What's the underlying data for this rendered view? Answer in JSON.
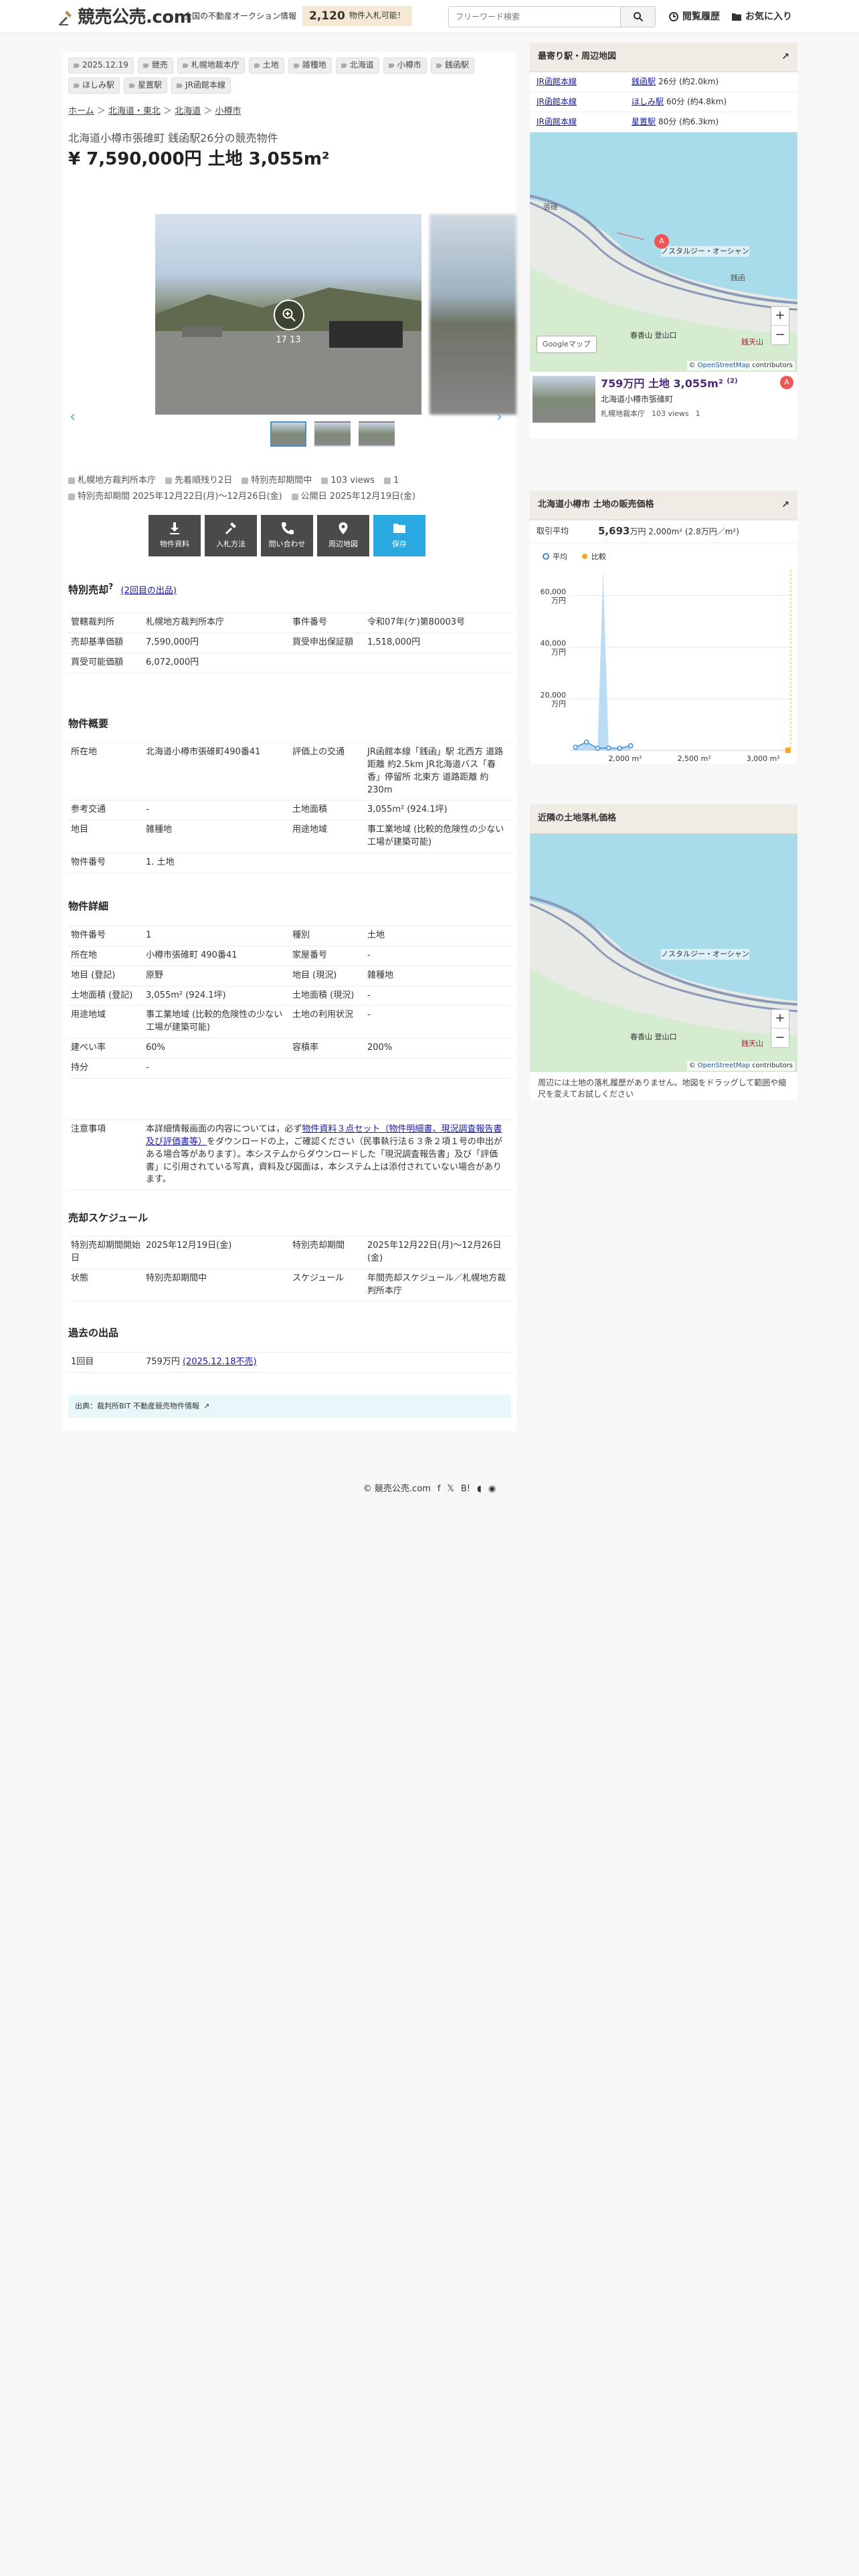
{
  "header": {
    "logo_text": "競売公売.com",
    "tagline": "全国の不動産オークション情報",
    "count_value": "2,120",
    "count_suffix": "物件入札可能！",
    "search_placeholder": "フリーワード検索",
    "history_label": "閲覧履歴",
    "favorites_label": "お気に入り"
  },
  "tags": [
    "2025.12.19",
    "競売",
    "札幌地裁本庁",
    "土地",
    "雑種地",
    "北海道",
    "小樽市",
    "銭函駅",
    "ほしみ駅",
    "星置駅",
    "JR函館本線"
  ],
  "breadcrumb": [
    "ホーム",
    "北海道・東北",
    "北海道",
    "小樽市"
  ],
  "listing": {
    "subtitle": "北海道小樽市張碓町 銭函駅26分の競売物件",
    "title": "¥ 7,590,000円 土地 3,055m²",
    "photo_count": "17 13"
  },
  "meta": {
    "court": "札幌地方裁判所本庁",
    "remaining": "先着順残り2日",
    "status": "特別売却期間中",
    "views": "103 views",
    "fav": "1",
    "period": "特別売却期間 2025年12月22日(月)〜12月26日(金)",
    "published": "公開日 2025年12月19日(金)"
  },
  "actions": [
    "物件資料",
    "入札方法",
    "問い合わせ",
    "周辺地図",
    "保存"
  ],
  "special_sale": {
    "heading": "特別売却",
    "sup": "?",
    "link": "(2回目の出品)",
    "rows": [
      {
        "k1": "管轄裁判所",
        "v1": "札幌地方裁判所本庁",
        "k2": "事件番号",
        "v2": "令和07年(ケ)第80003号"
      },
      {
        "k1": "売却基準価額",
        "v1": "7,590,000円",
        "k2": "買受申出保証額",
        "v2": "1,518,000円"
      },
      {
        "k1": "買受可能価額",
        "v1": "6,072,000円",
        "k2": "",
        "v2": ""
      }
    ]
  },
  "overview": {
    "heading": "物件概要",
    "rows": [
      {
        "k1": "所在地",
        "v1": "北海道小樽市張碓町490番41",
        "k2": "評価上の交通",
        "v2": "JR函館本線「銭函」駅 北西方 道路距離 約2.5km JR北海道バス「春香」停留所 北東方 道路距離 約230m"
      },
      {
        "k1": "参考交通",
        "v1": "-",
        "k2": "土地面積",
        "v2": "3,055m² (924.1坪)"
      },
      {
        "k1": "地目",
        "v1": "雑種地",
        "k2": "用途地域",
        "v2": "事工業地域 (比較的危険性の少ない工場が建築可能)"
      },
      {
        "k1": "物件番号",
        "v1": "1. 土地",
        "k2": "",
        "v2": ""
      }
    ]
  },
  "details": {
    "heading": "物件詳細",
    "rows": [
      {
        "k1": "物件番号",
        "v1": "1",
        "k2": "種別",
        "v2": "土地"
      },
      {
        "k1": "所在地",
        "v1": "小樽市張碓町 490番41",
        "k2": "家屋番号",
        "v2": "-"
      },
      {
        "k1": "地目 (登記)",
        "v1": "原野",
        "k2": "地目 (現況)",
        "v2": "雑種地"
      },
      {
        "k1": "土地面積 (登記)",
        "v1": "3,055m² (924.1坪)",
        "k2": "土地面積 (現況)",
        "v2": "-"
      },
      {
        "k1": "用途地域",
        "v1": "事工業地域 (比較的危険性の少ない工場が建築可能)",
        "k2": "土地の利用状況",
        "v2": "-"
      },
      {
        "k1": "建ぺい率",
        "v1": "60%",
        "k2": "容積率",
        "v2": "200%"
      },
      {
        "k1": "持分",
        "v1": "-",
        "k2": "",
        "v2": ""
      }
    ]
  },
  "notes": {
    "label": "注意事項",
    "text1": "本詳細情報画面の内容については，必ず",
    "link": "物件資料３点セット（物件明細書、現況調査報告書及び評価書等）",
    "text2": "をダウンロードの上，ご確認ください（民事執行法６３条２項１号の申出がある場合等があります）。本システムからダウンロードした「現況調査報告書」及び「評価書」に引用されている写真，資料及び図面は，本システム上は添付されていない場合があります。"
  },
  "schedule": {
    "heading": "売却スケジュール",
    "rows": [
      {
        "k1": "特別売却期間開始日",
        "v1": "2025年12月19日(金)",
        "k2": "特別売却期間",
        "v2": "2025年12月22日(月)〜12月26日(金)"
      },
      {
        "k1": "状態",
        "v1": "特別売却期間中",
        "k2": "スケジュール",
        "v2": "年間売却スケジュール／札幌地方裁判所本庁"
      }
    ]
  },
  "past": {
    "heading": "過去の出品",
    "k": "1回目",
    "v": "759万円",
    "link": "(2025.12.18不売)"
  },
  "source": "出典：裁判所BIT 不動産競売物件情報",
  "footer": "© 競売公売.com",
  "nearby": {
    "heading": "最寄り駅・周辺地図",
    "rows": [
      {
        "line": "JR函館本線",
        "station": "銭函駅",
        "info": "26分 (約2.0km)"
      },
      {
        "line": "JR函館本線",
        "station": "ほしみ駅",
        "info": "60分 (約4.8km)"
      },
      {
        "line": "JR函館本線",
        "station": "星置駅",
        "info": "80分 (約6.3km)"
      }
    ],
    "map_labels": [
      "張碓",
      "銭函",
      "ノスタルジー・オーシャン",
      "春香山 登山口",
      "銭天山"
    ],
    "google_btn": "Googleマップ",
    "osm_prefix": "©",
    "osm_link": "OpenStreetMap",
    "osm_suffix": "contributors",
    "marker": "A",
    "card_price": "759万円 土地 3,055m²",
    "card_price_sup": "(2)",
    "card_addr": "北海道小樽市張碓町",
    "card_court": "札幌地裁本庁",
    "card_views": "103 views",
    "card_fav": "1"
  },
  "price_chart": {
    "heading": "北海道小樽市 土地の販売価格",
    "avg_label": "取引平均",
    "avg_value": "5,693",
    "avg_unit": "万円 2,000m² (2.8万円／m²)",
    "legend": [
      "平均",
      "比較"
    ]
  },
  "chart_data": {
    "type": "area",
    "yticks": [
      "20,000\n万円",
      "40,000\n万円",
      "60,000\n万円"
    ],
    "xticks": [
      "2,000 m²",
      "2,500 m²",
      "3,000 m²"
    ],
    "ylim": [
      0,
      70000
    ],
    "xlim": [
      1600,
      3200
    ],
    "series": [
      {
        "name": "平均",
        "x": [
          1640,
          1720,
          1800,
          1880,
          1960,
          2040
        ],
        "values": [
          1200,
          3200,
          800,
          900,
          800,
          1800
        ]
      },
      {
        "name": "比較",
        "x": [
          3180
        ],
        "values": [
          0
        ]
      }
    ],
    "spike": {
      "x": 1840,
      "value": 72000
    }
  },
  "land_price": {
    "heading": "近隣の土地落札価格",
    "note": "周辺には土地の落札履歴がありません。地図をドラッグして範囲や縮尺を変えてお試しください"
  }
}
